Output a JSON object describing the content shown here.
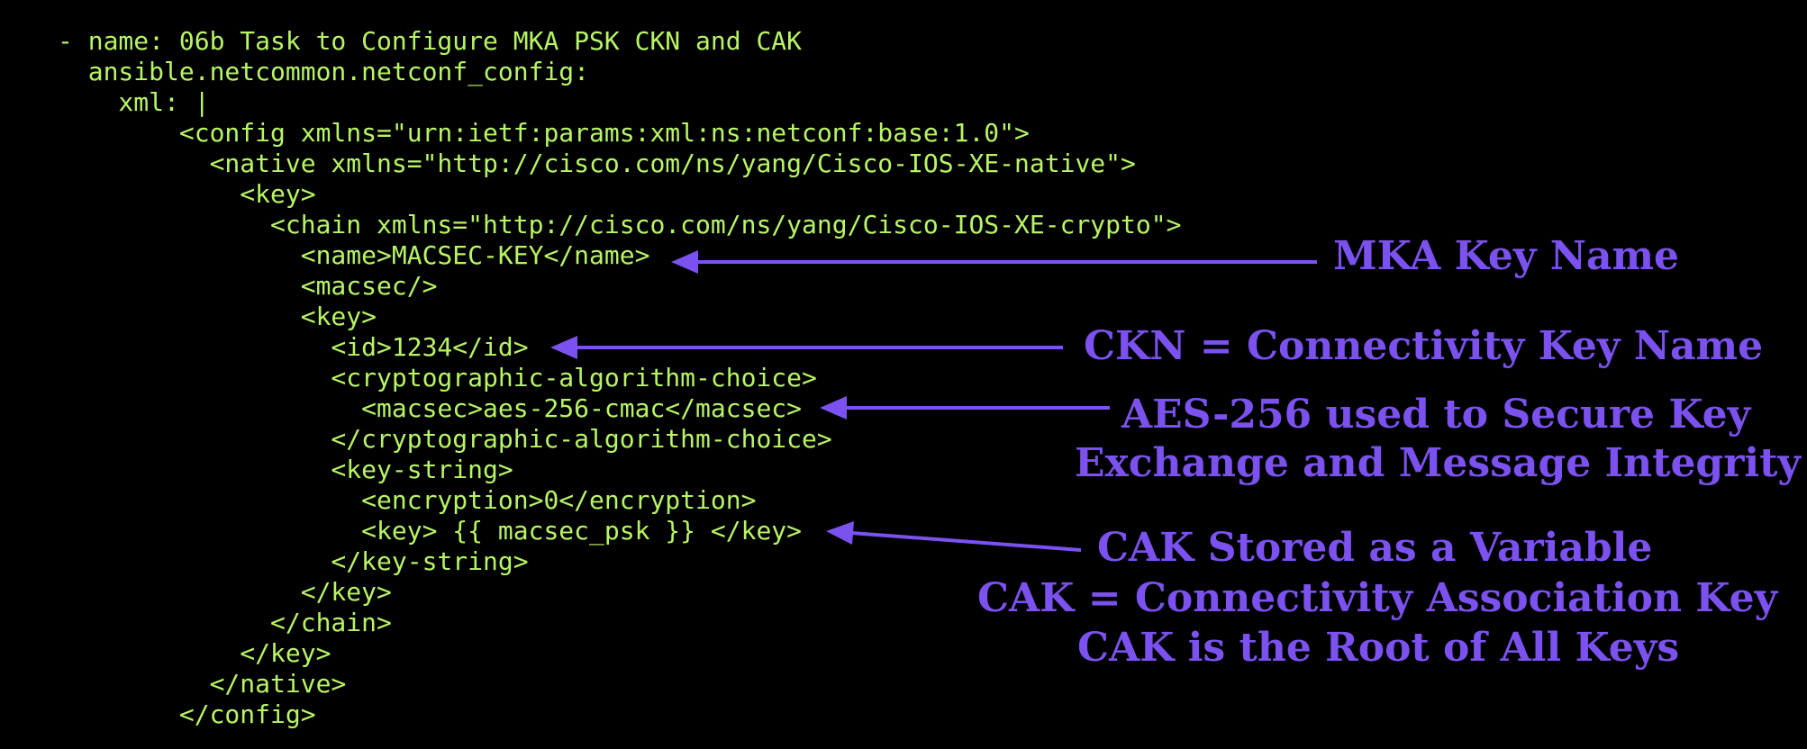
{
  "colors": {
    "background": "#000000",
    "code": "#b7f566",
    "annotation": "#7b52f0"
  },
  "code_lines": [
    "- name: 06b Task to Configure MKA PSK CKN and CAK",
    "  ansible.netcommon.netconf_config:",
    "    xml: |",
    "        <config xmlns=\"urn:ietf:params:xml:ns:netconf:base:1.0\">",
    "          <native xmlns=\"http://cisco.com/ns/yang/Cisco-IOS-XE-native\">",
    "            <key>",
    "              <chain xmlns=\"http://cisco.com/ns/yang/Cisco-IOS-XE-crypto\">",
    "                <name>MACSEC-KEY</name>",
    "                <macsec/>",
    "                <key>",
    "                  <id>1234</id>",
    "                  <cryptographic-algorithm-choice>",
    "                    <macsec>aes-256-cmac</macsec>",
    "                  </cryptographic-algorithm-choice>",
    "                  <key-string>",
    "                    <encryption>0</encryption>",
    "                    <key> {{ macsec_psk }} </key>",
    "                  </key-string>",
    "                </key>",
    "              </chain>",
    "            </key>",
    "          </native>",
    "        </config>"
  ],
  "annotations": {
    "mka_key_name": "MKA Key Name",
    "ckn": "CKN = Connectivity Key Name",
    "aes_line1": "AES-256 used to Secure Key",
    "aes_line2": "Exchange and Message Integrity",
    "cak_line1": "CAK Stored as a Variable",
    "cak_line2": "CAK = Connectivity Association Key",
    "cak_line3": "CAK is the Root of All Keys"
  }
}
